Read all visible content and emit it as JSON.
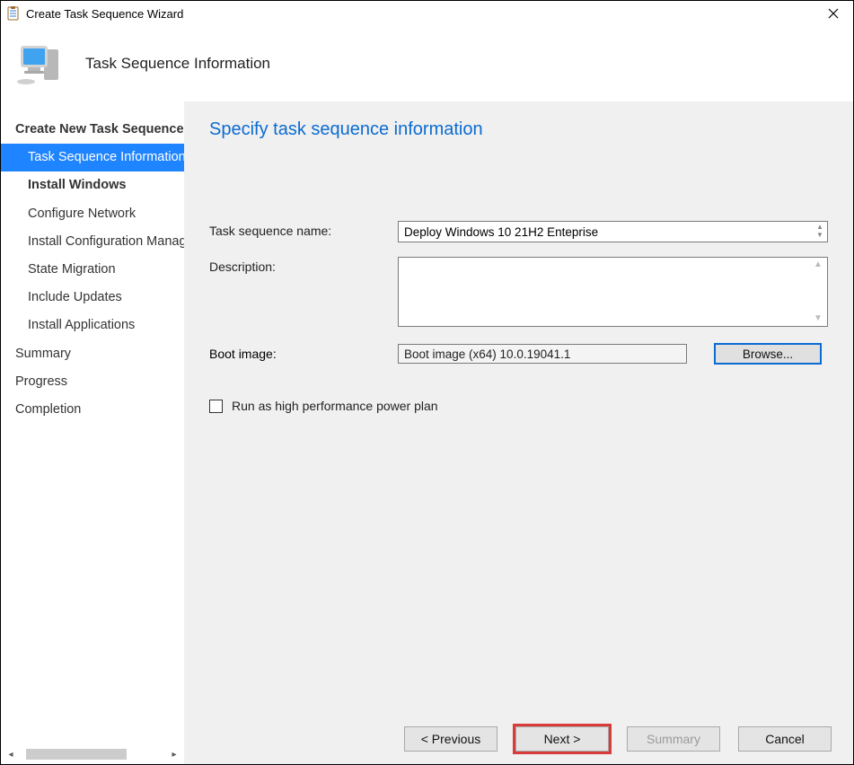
{
  "window": {
    "title": "Create Task Sequence Wizard"
  },
  "header": {
    "heading": "Task Sequence Information"
  },
  "sidebar": {
    "items": [
      {
        "label": "Create New Task Sequence",
        "indent": false,
        "bold": true,
        "selected": false
      },
      {
        "label": "Task Sequence Information",
        "indent": true,
        "bold": false,
        "selected": true
      },
      {
        "label": "Install Windows",
        "indent": true,
        "bold": true,
        "selected": false
      },
      {
        "label": "Configure Network",
        "indent": true,
        "bold": false,
        "selected": false
      },
      {
        "label": "Install Configuration Manager",
        "indent": true,
        "bold": false,
        "selected": false
      },
      {
        "label": "State Migration",
        "indent": true,
        "bold": false,
        "selected": false
      },
      {
        "label": "Include Updates",
        "indent": true,
        "bold": false,
        "selected": false
      },
      {
        "label": "Install Applications",
        "indent": true,
        "bold": false,
        "selected": false
      },
      {
        "label": "Summary",
        "indent": false,
        "bold": false,
        "selected": false
      },
      {
        "label": "Progress",
        "indent": false,
        "bold": false,
        "selected": false
      },
      {
        "label": "Completion",
        "indent": false,
        "bold": false,
        "selected": false
      }
    ]
  },
  "main": {
    "title": "Specify task sequence information",
    "labels": {
      "task_sequence_name": "Task sequence name:",
      "description": "Description:",
      "boot_image": "Boot image:"
    },
    "values": {
      "task_sequence_name": "Deploy Windows 10 21H2 Enteprise",
      "description": "",
      "boot_image": "Boot image (x64) 10.0.19041.1"
    },
    "browse_label": "Browse...",
    "checkbox_label": "Run as high performance power plan",
    "checkbox_checked": false
  },
  "footer": {
    "previous": "< Previous",
    "next": "Next >",
    "summary": "Summary",
    "cancel": "Cancel"
  }
}
